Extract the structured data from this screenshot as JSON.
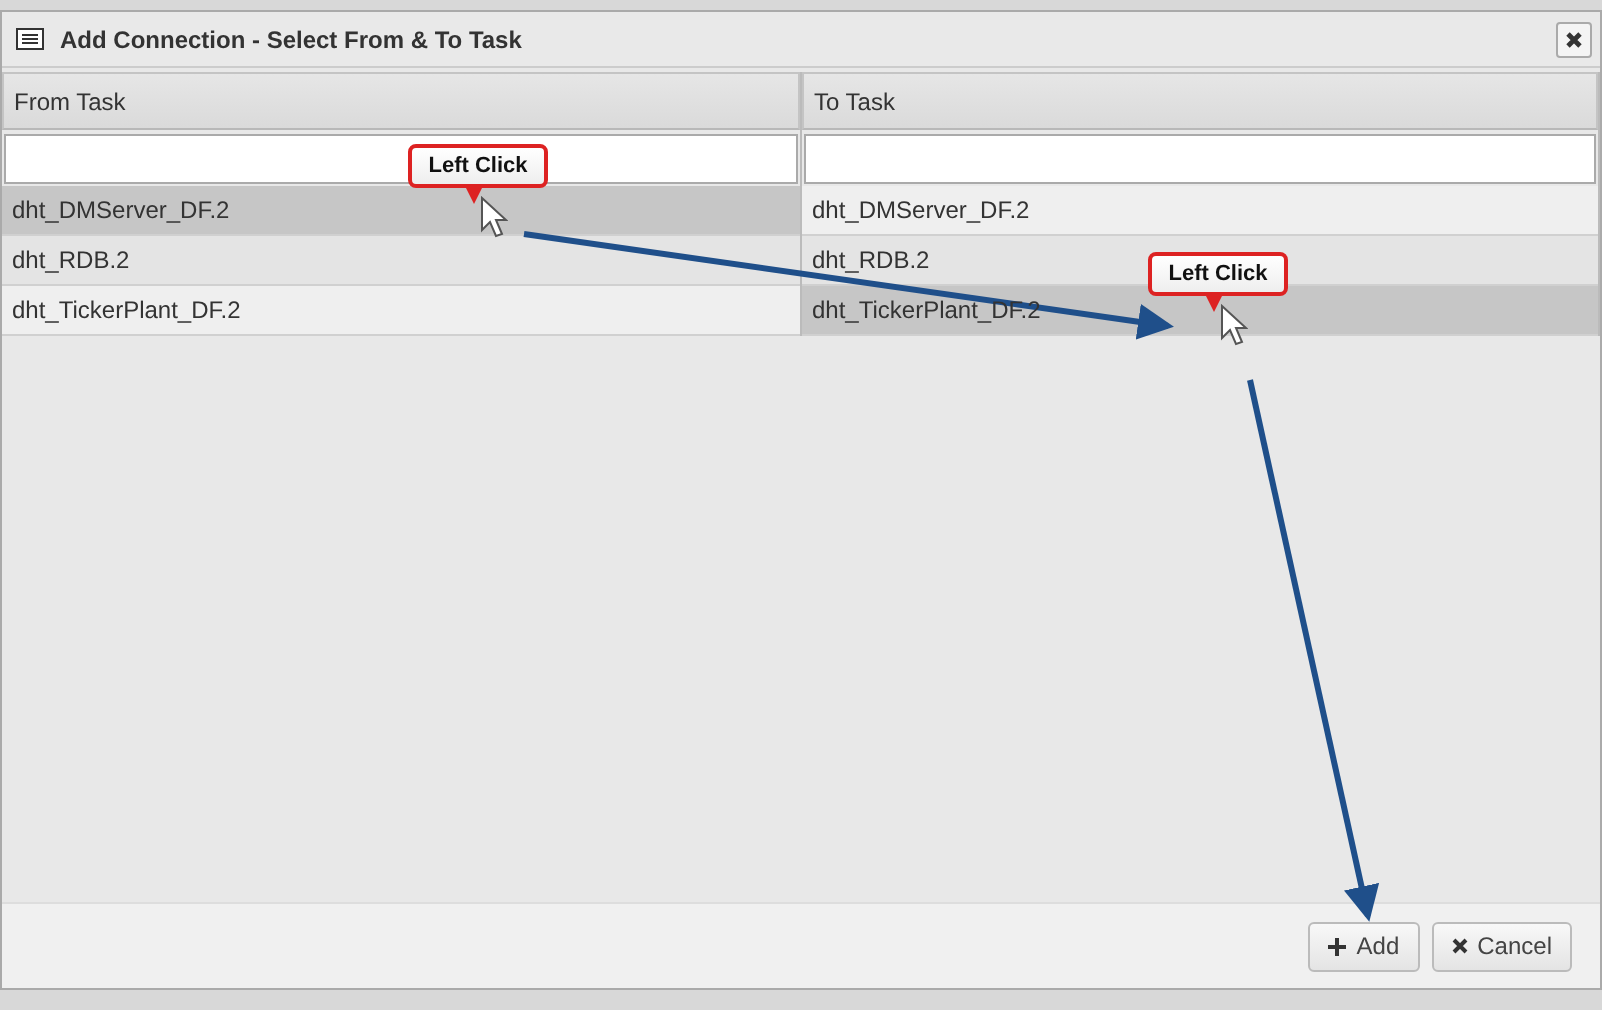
{
  "dialog": {
    "title": "Add Connection - Select From & To Task"
  },
  "columns": [
    {
      "heading": "From Task",
      "rows": [
        {
          "label": "dht_DMServer_DF.2",
          "selected": true
        },
        {
          "label": "dht_RDB.2",
          "selected": false
        },
        {
          "label": "dht_TickerPlant_DF.2",
          "selected": false
        }
      ]
    },
    {
      "heading": "To Task",
      "rows": [
        {
          "label": "dht_DMServer_DF.2",
          "selected": false
        },
        {
          "label": "dht_RDB.2",
          "selected": false
        },
        {
          "label": "dht_TickerPlant_DF.2",
          "selected": true
        }
      ]
    }
  ],
  "callouts": [
    "Left Click",
    "Left Click"
  ],
  "buttons": [
    {
      "kind": "add",
      "label": "Add"
    },
    {
      "kind": "cancel",
      "label": "Cancel"
    }
  ]
}
